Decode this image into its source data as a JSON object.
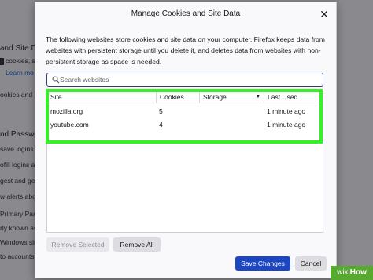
{
  "background_page": {
    "lines": [
      {
        "text": "and Site Da",
        "style": "head"
      },
      {
        "text": "cookies, site",
        "style": "checkbox"
      },
      {
        "text": "Learn mo",
        "style": "link"
      },
      {
        "text": "ookies and",
        "style": "normal"
      },
      {
        "text": "nd Passwo",
        "style": "head"
      },
      {
        "text": "save logins a",
        "style": "normal"
      },
      {
        "text": "ofill logins a",
        "style": "normal"
      },
      {
        "text": "gest and gen",
        "style": "normal"
      },
      {
        "text": "w alerts abo",
        "style": "normal"
      },
      {
        "text": "Primary Pass",
        "style": "normal"
      },
      {
        "text": "rly known as M",
        "style": "normal"
      },
      {
        "text": "Windows sin",
        "style": "normal"
      },
      {
        "text": "to accounts in",
        "style": "normal"
      }
    ]
  },
  "dialog": {
    "title": "Manage Cookies and Site Data",
    "close_glyph": "✕",
    "description": "The following websites store cookies and site data on your computer. Firefox keeps data from websites with persistent storage until you delete it, and deletes data from websites with non-persistent storage as space is needed.",
    "search": {
      "placeholder": "Search websites",
      "value": ""
    },
    "table": {
      "columns": [
        "Site",
        "Cookies",
        "Storage",
        "Last Used"
      ],
      "sort_glyph": "▼",
      "rows": [
        {
          "site": "mozilla.org",
          "cookies": "5",
          "storage": "",
          "last_used": "1 minute ago"
        },
        {
          "site": "youtube.com",
          "cookies": "4",
          "storage": "",
          "last_used": "1 minute ago"
        }
      ]
    },
    "buttons": {
      "remove_selected": "Remove Selected",
      "remove_all": "Remove All",
      "save": "Save Changes",
      "cancel": "Cancel"
    }
  },
  "colors": {
    "highlight": "#39ef2a",
    "primary_button": "#1d46c2",
    "watermark": "#58a92f"
  },
  "watermark": {
    "prefix": "wiki",
    "suffix": "How"
  }
}
